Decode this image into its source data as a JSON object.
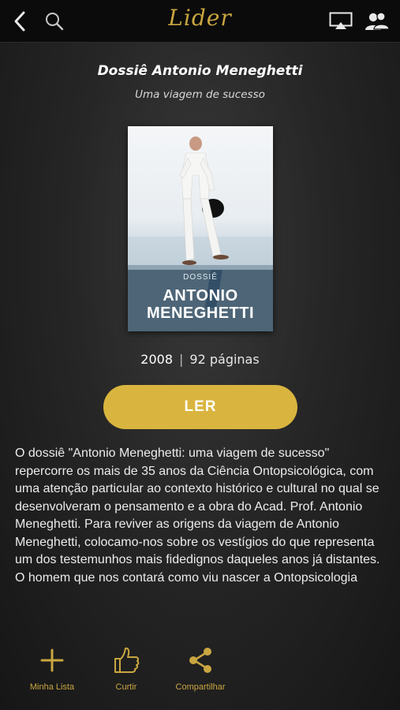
{
  "app": {
    "logo": "Lider"
  },
  "book": {
    "title": "Dossiê Antonio Meneghetti",
    "subtitle": "Uma viagem de sucesso",
    "cover": {
      "kicker": "DOSSIÊ",
      "name_line1": "ANTONIO",
      "name_line2": "MENEGHETTI"
    },
    "year": "2008",
    "separator": "|",
    "pages": "92 páginas"
  },
  "read_button": {
    "label": "LER"
  },
  "description": "O dossiê \"Antonio Meneghetti: uma viagem de sucesso\" repercorre os mais de 35 anos da Ciência Ontopsicológica, com uma atenção particular ao contexto histórico e cultural no qual se desenvolveram o pensamento e a obra do Acad. Prof. Antonio Meneghetti. Para reviver as origens da viagem de Antonio Meneghetti, colocamo-nos sobre os vestígios do que representa um dos testemunhos mais fidedignos daqueles anos já distantes. O homem que nos contará como viu nascer a Ontopsicologia",
  "actions": [
    {
      "label": "Minha Lista",
      "icon": "plus-icon"
    },
    {
      "label": "Curtir",
      "icon": "thumbs-up-icon"
    },
    {
      "label": "Compartilhar",
      "icon": "share-icon"
    }
  ],
  "colors": {
    "accent": "#d9b53f",
    "logo": "#c9a640",
    "background": "#1e1e1e",
    "navbar": "#0b0b0b"
  }
}
